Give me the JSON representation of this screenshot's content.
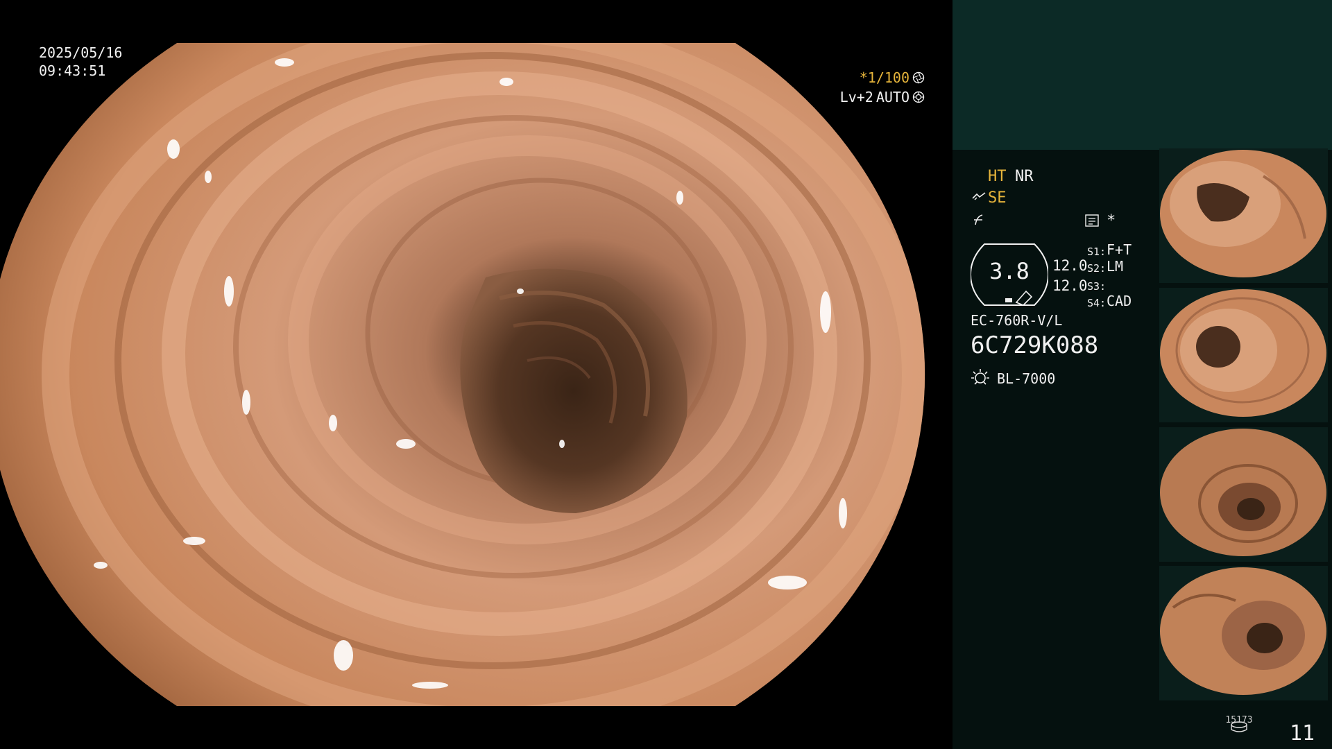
{
  "overlay": {
    "date": "2025/05/16",
    "time": "09:43:51",
    "shutter": "*1/100",
    "level": "Lv+2",
    "exposure_mode": "AUTO"
  },
  "status": {
    "ht": "HT",
    "nr": "NR",
    "se": "SE",
    "star": "*",
    "gauge_value": "3.8",
    "value_a": "12.0",
    "value_b": "12.0",
    "switches": [
      {
        "label": "S1:",
        "value": "F+T"
      },
      {
        "label": "S2:",
        "value": "LM"
      },
      {
        "label": "S3:",
        "value": ""
      },
      {
        "label": "S4:",
        "value": "CAD"
      }
    ],
    "scope_model": "EC-760R-V/L",
    "scope_serial": "6C729K088",
    "light_source": "BL-7000",
    "image_count": "15173",
    "page_number": "11"
  },
  "icons": {
    "shutter": "aperture-icon",
    "level": "iris-icon",
    "se": "scope-tip-icon",
    "flash": "flash-icon",
    "memo": "memo-icon",
    "light": "light-source-icon",
    "counter": "storage-icon"
  },
  "colors": {
    "accent_yellow": "#e7b53b",
    "panel_top": "#0c2a26",
    "panel_bottom": "#05110f",
    "mucosa": "#c8825a"
  }
}
